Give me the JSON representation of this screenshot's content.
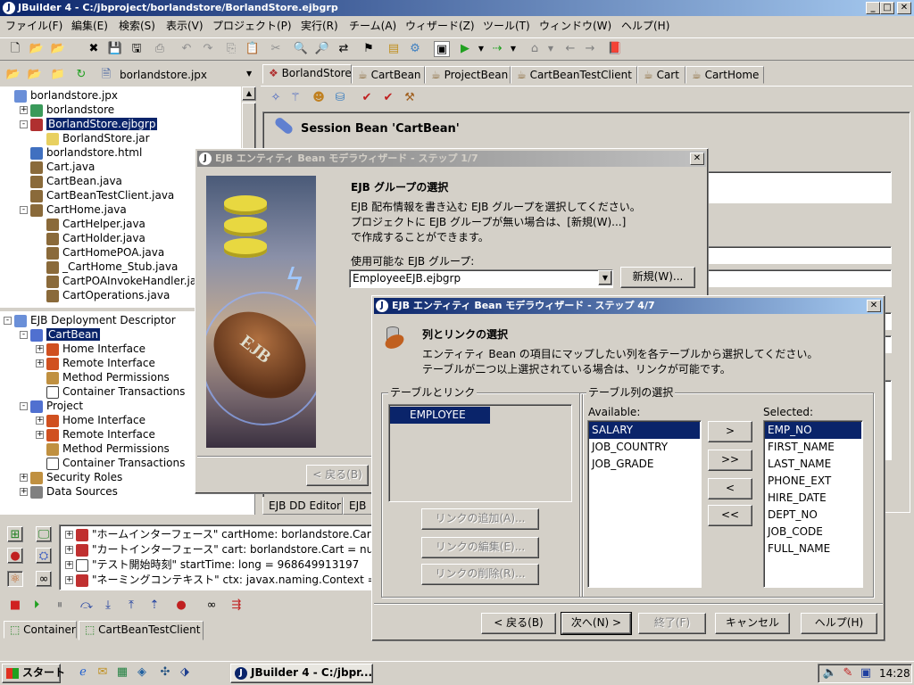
{
  "app": {
    "title": "JBuilder 4 - C:/jbproject/borlandstore/BorlandStore.ejbgrp",
    "menu": [
      "ファイル(F)",
      "編集(E)",
      "検索(S)",
      "表示(V)",
      "プロジェクト(P)",
      "実行(R)",
      "チーム(A)",
      "ウィザード(Z)",
      "ツール(T)",
      "ウィンドウ(W)",
      "ヘルプ(H)"
    ]
  },
  "project": {
    "selector": "borlandstore.jpx",
    "tree": [
      {
        "label": "borlandstore.jpx",
        "indent": 0,
        "exp": "",
        "icon": "#6a8fd8"
      },
      {
        "label": "borlandstore",
        "indent": 1,
        "exp": "+",
        "icon": "#3a9a5a"
      },
      {
        "label": "BorlandStore.ejbgrp",
        "indent": 1,
        "exp": "-",
        "icon": "#b03030",
        "selected": true
      },
      {
        "label": "BorlandStore.jar",
        "indent": 2,
        "exp": "",
        "icon": "#e8d060"
      },
      {
        "label": "borlandstore.html",
        "indent": 1,
        "exp": "",
        "icon": "#4070c0"
      },
      {
        "label": "Cart.java",
        "indent": 1,
        "exp": "",
        "icon": "#8a6a3a"
      },
      {
        "label": "CartBean.java",
        "indent": 1,
        "exp": "",
        "icon": "#8a6a3a"
      },
      {
        "label": "CartBeanTestClient.java",
        "indent": 1,
        "exp": "",
        "icon": "#8a6a3a"
      },
      {
        "label": "CartHome.java",
        "indent": 1,
        "exp": "-",
        "icon": "#8a6a3a"
      },
      {
        "label": "CartHelper.java",
        "indent": 2,
        "exp": "",
        "icon": "#8a6a3a"
      },
      {
        "label": "CartHolder.java",
        "indent": 2,
        "exp": "",
        "icon": "#8a6a3a"
      },
      {
        "label": "CartHomePOA.java",
        "indent": 2,
        "exp": "",
        "icon": "#8a6a3a"
      },
      {
        "label": "_CartHome_Stub.java",
        "indent": 2,
        "exp": "",
        "icon": "#8a6a3a"
      },
      {
        "label": "CartPOAInvokeHandler.java",
        "indent": 2,
        "exp": "",
        "icon": "#8a6a3a"
      },
      {
        "label": "CartOperations.java",
        "indent": 2,
        "exp": "",
        "icon": "#8a6a3a"
      }
    ]
  },
  "structure": {
    "tree": [
      {
        "label": "EJB Deployment Descriptor",
        "indent": 0,
        "exp": "-",
        "icon": "#6a8fd8"
      },
      {
        "label": "CartBean",
        "indent": 1,
        "exp": "-",
        "icon": "#5070d0",
        "selected": true
      },
      {
        "label": "Home Interface",
        "indent": 2,
        "exp": "+",
        "icon": "#d05020"
      },
      {
        "label": "Remote Interface",
        "indent": 2,
        "exp": "+",
        "icon": "#d05020"
      },
      {
        "label": "Method Permissions",
        "indent": 2,
        "exp": "",
        "icon": "#c09040"
      },
      {
        "label": "Container Transactions",
        "indent": 2,
        "exp": "",
        "icon": "#ffffff"
      },
      {
        "label": "Project",
        "indent": 1,
        "exp": "-",
        "icon": "#5070d0"
      },
      {
        "label": "Home Interface",
        "indent": 2,
        "exp": "+",
        "icon": "#d05020"
      },
      {
        "label": "Remote Interface",
        "indent": 2,
        "exp": "+",
        "icon": "#d05020"
      },
      {
        "label": "Method Permissions",
        "indent": 2,
        "exp": "",
        "icon": "#c09040"
      },
      {
        "label": "Container Transactions",
        "indent": 2,
        "exp": "",
        "icon": "#ffffff"
      },
      {
        "label": "Security Roles",
        "indent": 1,
        "exp": "+",
        "icon": "#c09040"
      },
      {
        "label": "Data Sources",
        "indent": 1,
        "exp": "+",
        "icon": "#808080"
      }
    ]
  },
  "editor": {
    "tabs": [
      "BorlandStore",
      "CartBean",
      "ProjectBean",
      "CartBeanTestClient",
      "Cart",
      "CartHome"
    ],
    "heading": "Session Bean 'CartBean'",
    "bottom_tabs": [
      "EJB DD Editor",
      "EJB"
    ]
  },
  "console": {
    "lines": [
      "\"ホームインターフェース\" cartHome: borlandstore.CartH",
      "\"カートインターフェース\" cart: borlandstore.Cart = null",
      "\"テスト開始時刻\" startTime: long = 968649913197",
      "\"ネーミングコンテキスト\" ctx: javax.naming.Context = {ja"
    ],
    "tabs": [
      "Container",
      "CartBeanTestClient"
    ]
  },
  "dialog1": {
    "title": "EJB エンティティ Bean モデラウィザード - ステップ 1/7",
    "heading": "EJB グループの選択",
    "desc1": "EJB 配布情報を書き込む EJB グループを選択してください。",
    "desc2": "プロジェクトに EJB グループが無い場合は、[新規(W)...]",
    "desc3": "で作成することができます。",
    "group_label": "使用可能な EJB グループ:",
    "group_value": "EmployeeEJB.ejbgrp",
    "new_button": "新規(W)...",
    "back_button": "< 戻る(B)",
    "art_text": "EJB"
  },
  "dialog2": {
    "title": "EJB エンティティ Bean モデラウィザード - ステップ 4/7",
    "heading": "列とリンクの選択",
    "desc1": "エンティティ Bean の項目にマップしたい列を各テーブルから選択してください。",
    "desc2": "テーブルが二つ以上選択されている場合は、リンクが可能です。",
    "tables_group": "テーブルとリンク",
    "tables": [
      "EMPLOYEE"
    ],
    "columns_group": "テーブル列の選択",
    "available_label": "Available:",
    "available": [
      "SALARY",
      "JOB_COUNTRY",
      "JOB_GRADE"
    ],
    "selected_label": "Selected:",
    "selected": [
      "EMP_NO",
      "FIRST_NAME",
      "LAST_NAME",
      "PHONE_EXT",
      "HIRE_DATE",
      "DEPT_NO",
      "JOB_CODE",
      "FULL_NAME"
    ],
    "move_buttons": [
      ">",
      ">>",
      "<",
      "<<"
    ],
    "link_add": "リンクの追加(A)...",
    "link_edit": "リンクの編集(E)...",
    "link_delete": "リンクの削除(R)...",
    "back": "< 戻る(B)",
    "next": "次へ(N) >",
    "finish": "終了(F)",
    "cancel": "キャンセル",
    "help": "ヘルプ(H)"
  },
  "taskbar": {
    "start": "スタート",
    "task": "JBuilder 4 - C:/jbpr...",
    "time": "14:28"
  }
}
